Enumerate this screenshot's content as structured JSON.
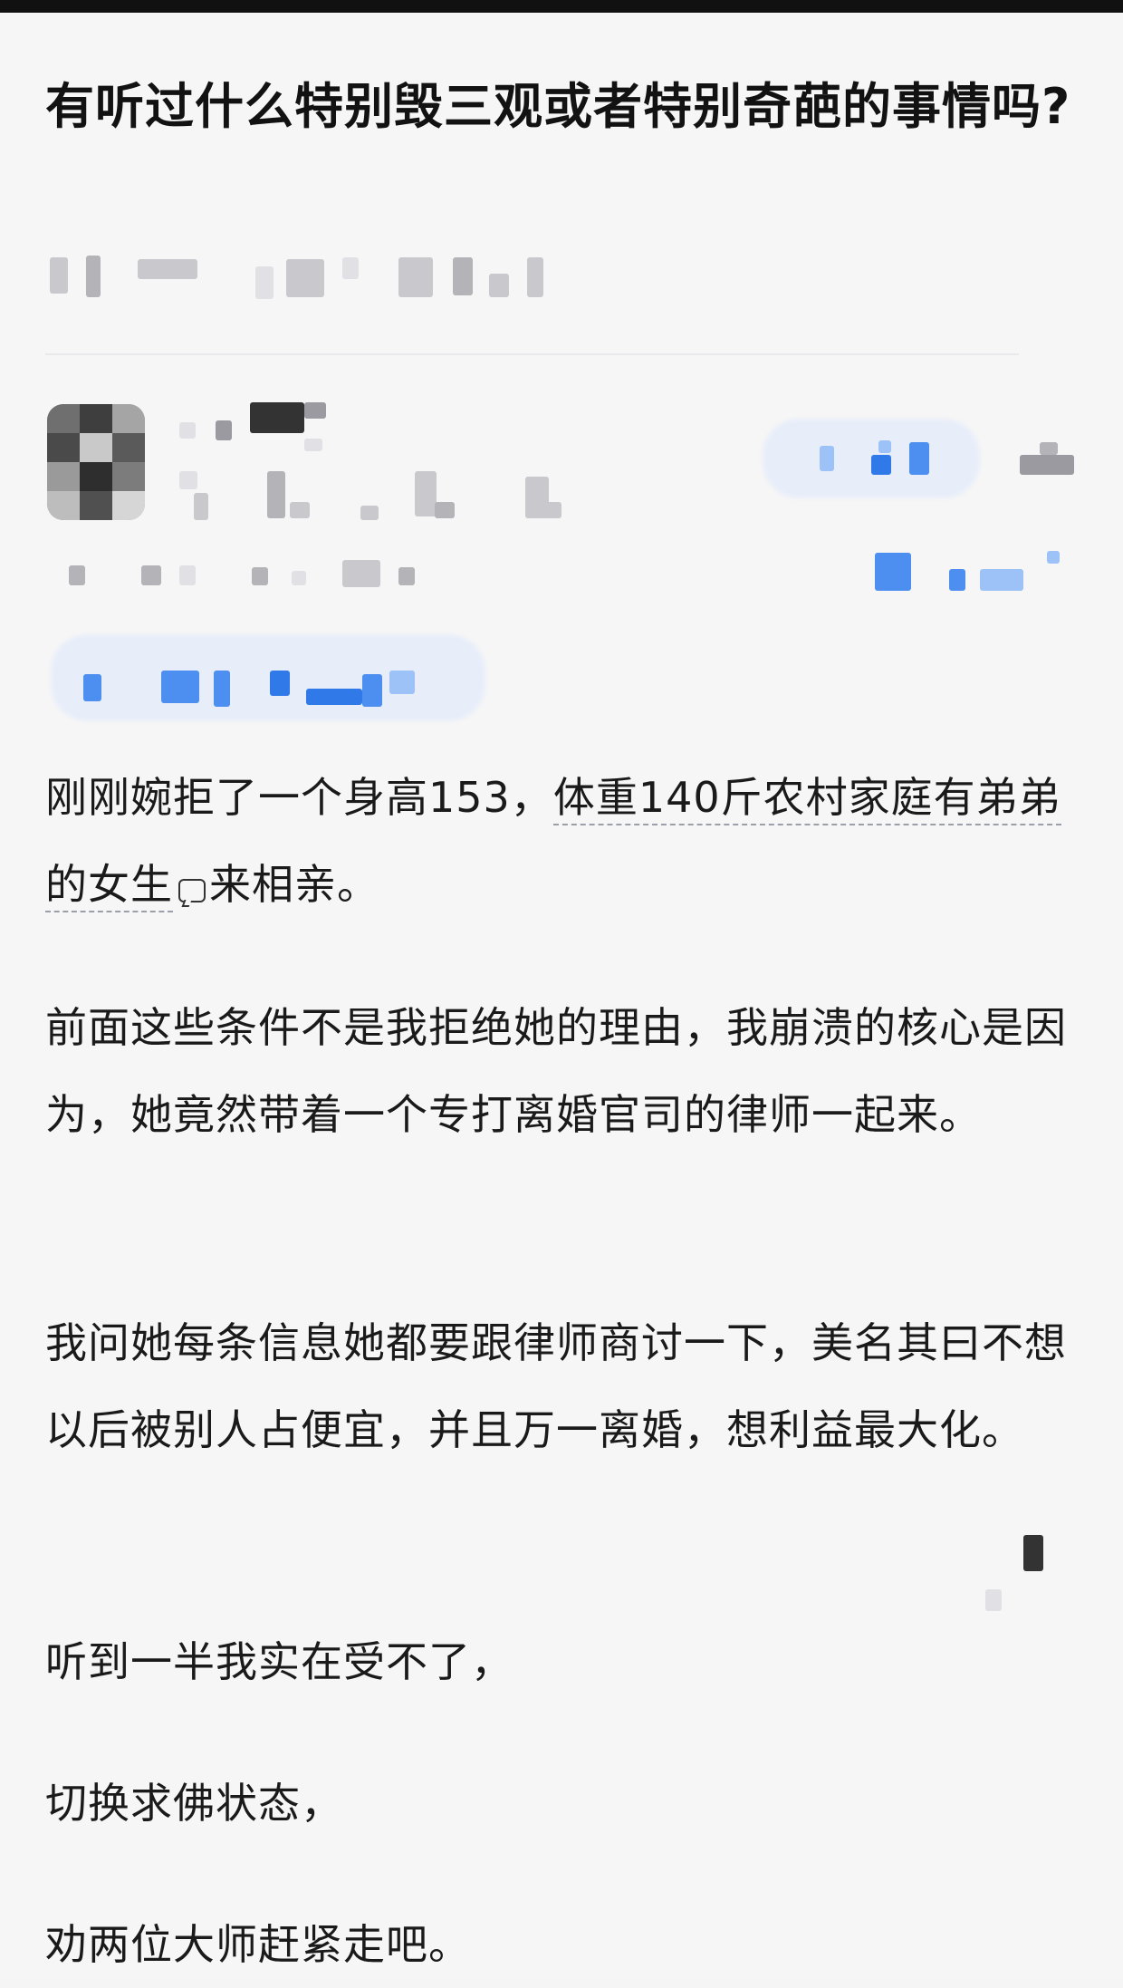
{
  "question": {
    "title": "有听过什么特别毁三观或者特别奇葩的事情吗?"
  },
  "answer": {
    "para1_before": "刚刚婉拒了一个身高153，",
    "para1_underlined": "体重140斤农村家庭有弟弟的女生",
    "para1_after": "来相亲。",
    "para2": "前面这些条件不是我拒绝她的理由，我崩溃的核心是因为，她竟然带着一个专打离婚官司的律师一起来。",
    "para3": "我问她每条信息她都要跟律师商讨一下，美名其曰不想以后被别人占便宜，并且万一离婚，想利益最大化。",
    "para4": "听到一半我实在受不了，",
    "para5": "切换求佛状态，",
    "para6": "劝两位大师赶紧走吧。"
  },
  "icons": {
    "comment": "comment-bubble-icon",
    "avatar": "pixelated-avatar"
  }
}
